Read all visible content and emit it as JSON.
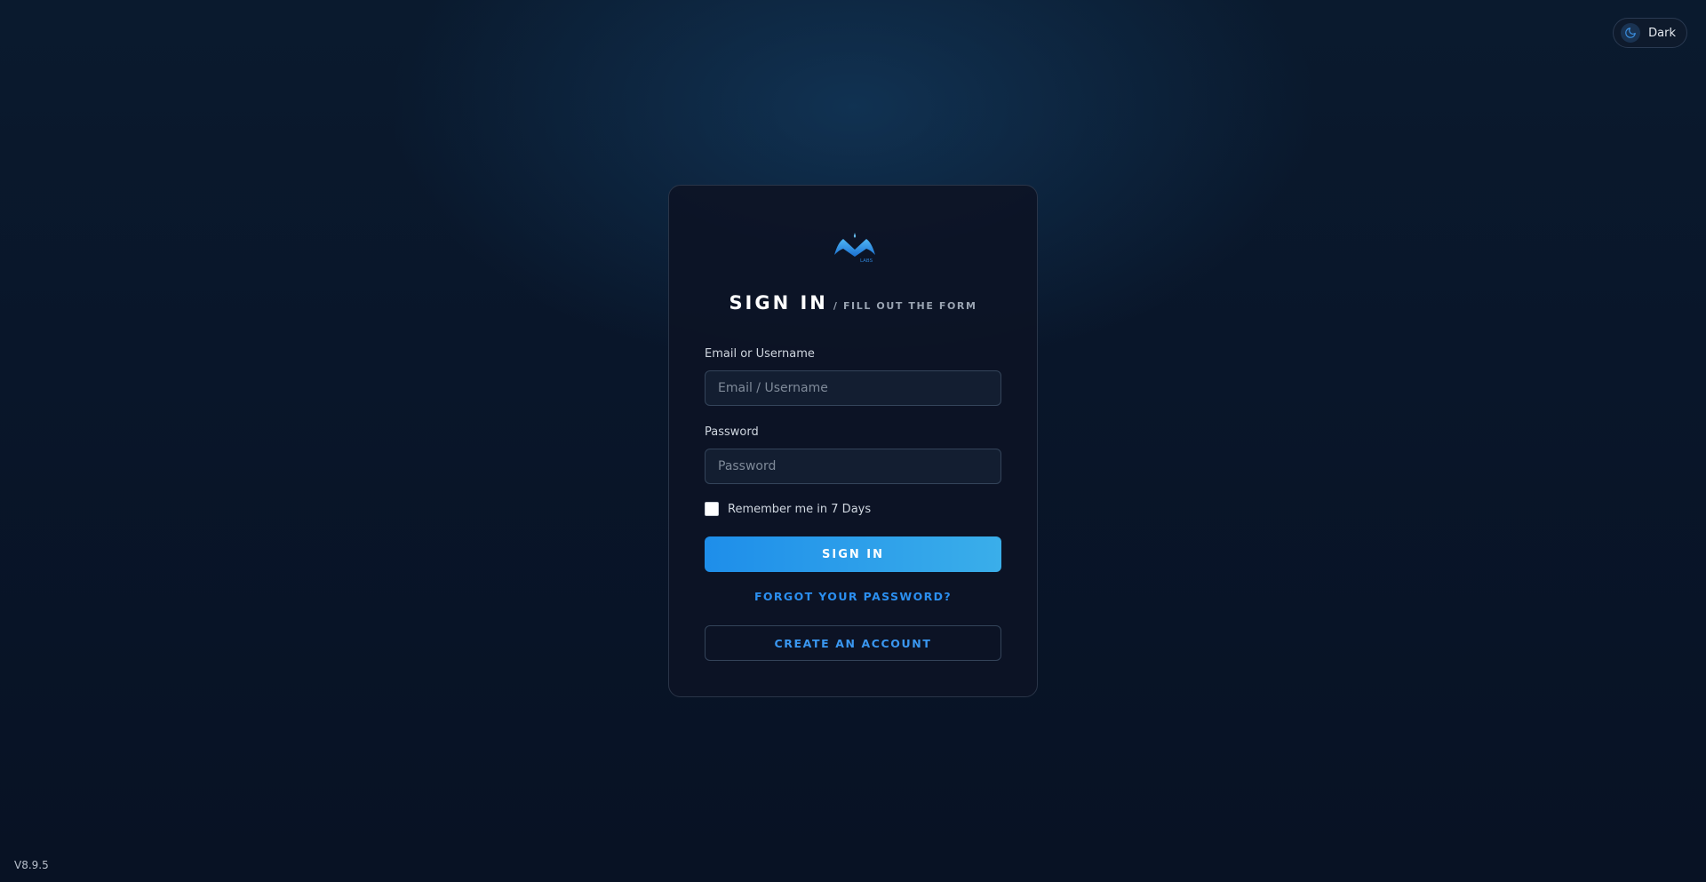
{
  "theme_toggle": {
    "label": "Dark",
    "icon": "moon-icon"
  },
  "logo": {
    "icon": "m-labs-logo",
    "text": "LABS"
  },
  "heading": {
    "title": "SIGN IN",
    "subtitle": "/ FILL OUT THE FORM"
  },
  "form": {
    "email": {
      "label": "Email or Username",
      "placeholder": "Email / Username",
      "value": ""
    },
    "password": {
      "label": "Password",
      "placeholder": "Password",
      "value": ""
    },
    "remember": {
      "label": "Remember me in 7 Days",
      "checked": false
    },
    "submit_label": "SIGN IN",
    "forgot_label": "FORGOT YOUR PASSWORD?",
    "create_label": "CREATE AN ACCOUNT"
  },
  "footer": {
    "version": "V8.9.5"
  },
  "colors": {
    "accent": "#2b8ff0",
    "button_gradient_start": "#1e8eea",
    "button_gradient_end": "#3aaeea",
    "background": "#0a1a2e",
    "card": "#0d1425"
  }
}
